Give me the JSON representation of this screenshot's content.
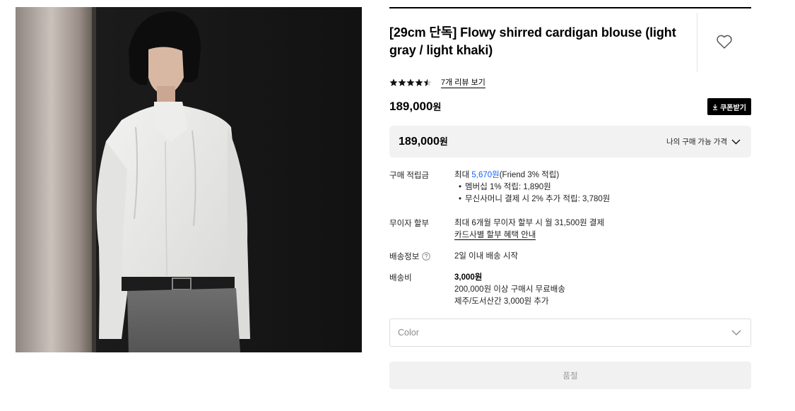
{
  "product": {
    "title": "[29cm 단독] Flowy shirred cardigan blouse (light gray / light khaki)",
    "image_icon": "product-photo",
    "wishlist_icon": "heart-outline-icon"
  },
  "rating": {
    "stars_value": 4.5,
    "stars_max": 5,
    "review_link": "7개 리뷰 보기"
  },
  "price": {
    "amount": "189,000",
    "unit": "원",
    "coupon_label": "쿠폰받기",
    "coupon_icon": "download-icon"
  },
  "price_box": {
    "amount": "189,000",
    "unit": "원",
    "my_price_label": "나의 구매 가능 가격",
    "chevron_icon": "chevron-down-icon"
  },
  "details": {
    "points": {
      "label": "구매 적립금",
      "line_prefix": "최대 ",
      "line_highlight": "5,670원",
      "line_suffix": "(Friend 3% 적립)",
      "bullet1": "멤버십 1% 적립: 1,890원",
      "bullet2": "무신사머니 결제 시 2% 추가 적립: 3,780원"
    },
    "installment": {
      "label": "무이자 할부",
      "line1": "최대 6개월 무이자 할부 시 월 31,500원 결제",
      "link": "카드사별 할부 혜택 안내"
    },
    "shipping": {
      "label": "배송정보",
      "help_icon": "question-circle-icon",
      "value": "2일 이내 배송 시작"
    },
    "shipping_fee": {
      "label": "배송비",
      "amount": "3,000원",
      "free_note": "200,000원 이상 구매시 무료배송",
      "island_note": "제주/도서산간 3,000원 추가"
    }
  },
  "option_select": {
    "placeholder": "Color",
    "chevron_icon": "chevron-down-icon"
  },
  "buy_button": {
    "label": "품절"
  },
  "colors": {
    "accent_blue": "#0f62fe",
    "black": "#000000",
    "box_gray": "#f2f2f2"
  }
}
